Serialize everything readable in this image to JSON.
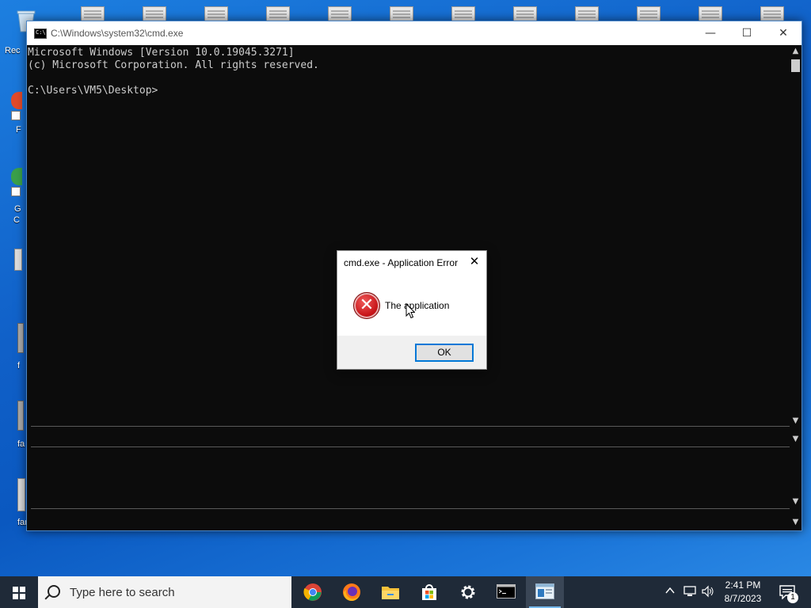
{
  "cmd_window": {
    "title": "C:\\Windows\\system32\\cmd.exe",
    "icon_text": "C:\\",
    "console_lines": [
      "Microsoft Windows [Version 10.0.19045.3271]",
      "(c) Microsoft Corporation. All rights reserved.",
      "",
      "C:\\Users\\VM5\\Desktop>"
    ],
    "minimize_glyph": "—",
    "maximize_glyph": "☐",
    "close_glyph": "✕"
  },
  "dialog": {
    "title": "cmd.exe - Application Error",
    "message": "The application",
    "ok_label": "OK",
    "close_glyph": "✕",
    "error_glyph": "✕"
  },
  "desktop": {
    "left_labels": [
      "Rec",
      "F",
      "G",
      "C",
      "f",
      "fa",
      "far"
    ]
  },
  "taskbar": {
    "search_placeholder": "Type here to search",
    "time": "2:41 PM",
    "date": "8/7/2023",
    "notification_count": "1",
    "apps": [
      "chrome-icon",
      "firefox-icon",
      "file-explorer-icon",
      "store-icon",
      "settings-icon",
      "cmd-icon",
      "app-window-icon"
    ],
    "tray_chevron": "^"
  },
  "colors": {
    "console_bg": "#0c0c0c",
    "console_text": "#cccccc",
    "taskbar_bg": "#1f2a38",
    "accent": "#0078d7"
  }
}
